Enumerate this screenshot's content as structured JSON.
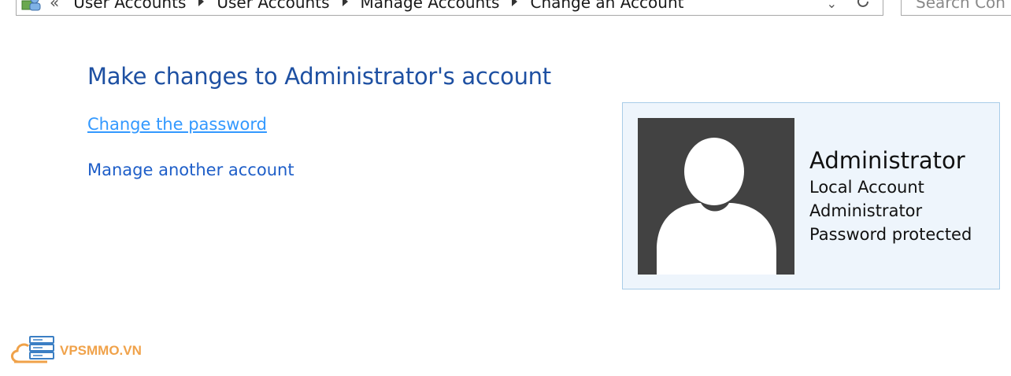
{
  "address_bar": {
    "overflow_glyph": "«",
    "breadcrumbs": [
      "User Accounts",
      "User Accounts",
      "Manage Accounts",
      "Change an Account"
    ],
    "dropdown_glyph": "⌄"
  },
  "search": {
    "placeholder": "Search Con"
  },
  "main": {
    "title": "Make changes to Administrator's account",
    "links": {
      "change_password": "Change the password",
      "manage_another": "Manage another account"
    }
  },
  "account": {
    "name": "Administrator",
    "details": [
      "Local Account",
      "Administrator",
      "Password protected"
    ]
  },
  "watermark": {
    "text": "VPSMMO.VN",
    "color": "#f0a24a"
  },
  "colors": {
    "title": "#1e50a2",
    "link": "#1e5ec8",
    "link_hover": "#3399ff",
    "card_bg": "#eef5fc",
    "card_border": "#a9cde8",
    "avatar_bg": "#424242"
  }
}
